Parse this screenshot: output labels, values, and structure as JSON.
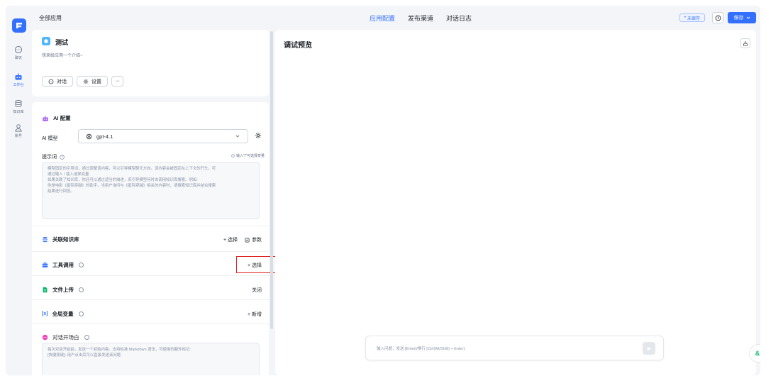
{
  "rail": {
    "items": [
      {
        "label": "聊天",
        "icon": "chat-icon"
      },
      {
        "label": "工作台",
        "icon": "robot-icon"
      },
      {
        "label": "知识库",
        "icon": "database-icon"
      },
      {
        "label": "账号",
        "icon": "user-icon"
      }
    ]
  },
  "header": {
    "breadcrumb": "全部应用",
    "tabs": [
      "应用配置",
      "发布渠道",
      "对话日志"
    ],
    "unsaved": "未保存",
    "save_label": "保存"
  },
  "app": {
    "name": "测试",
    "intro": "快来给应用一个介绍~",
    "chat_btn": "对话",
    "settings_btn": "设置",
    "more_btn": "···"
  },
  "ai_config": {
    "title": "AI 配置",
    "model_label": "AI 模型",
    "model_value": "gpt-4.1",
    "prompt_label": "提示词",
    "prompt_hint": "输入\"/\"可选择变量",
    "prompt_placeholder_lines": [
      "模型固定的引导词，通过调整该内容，可以引导模型聊天方向。该内容会被固定在上下文的开头。可",
      "通过输入 / 插入选择变量",
      "如果关联了知识库，你还可以通过适当的描述，来引导模型何时去调用知识库搜索。例如:",
      "你是电影《星际穿越》的助手，当用户询问与《星际穿越》相关的内容时，请搜索知识库并结合搜索",
      "结果进行回答。"
    ]
  },
  "sections": {
    "knowledge": {
      "title": "关联知识库",
      "select": "+ 选择",
      "params": "参数"
    },
    "tools": {
      "title": "工具调用",
      "select": "+ 选择"
    },
    "file_upload": {
      "title": "文件上传",
      "status": "关闭"
    },
    "variables": {
      "title": "全局变量",
      "add": "+ 新增"
    },
    "opener": {
      "title": "对话开场白",
      "placeholder_lines": [
        "每次对话开始前，发送一个初始内容。支持标准 Markdown 语法，可使用的额外标记:",
        "[快捷按键]: 用户点击后可以直接发送该问题"
      ]
    }
  },
  "preview": {
    "title": "调试预览",
    "input_placeholder": "输入问题，发送 [Enter]/换行 [Ctrl(Alt/Shift) + Enter]"
  },
  "colors": {
    "accent": "#3370ff",
    "highlight": "#e02020"
  }
}
